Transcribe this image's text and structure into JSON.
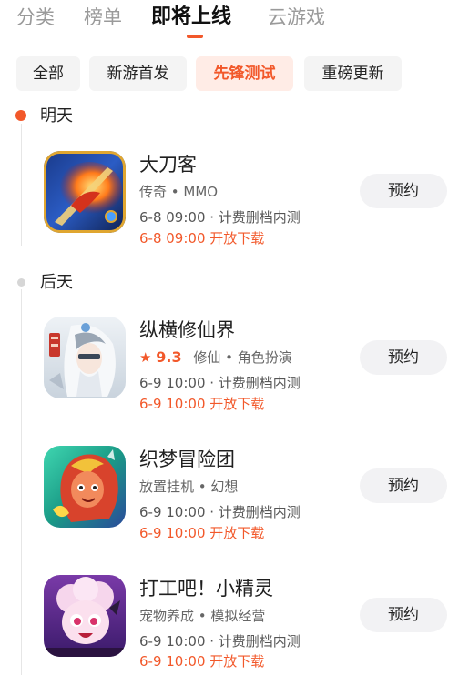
{
  "tabs": [
    {
      "label": "分类",
      "active": false
    },
    {
      "label": "榜单",
      "active": false
    },
    {
      "label": "即将上线",
      "active": true
    },
    {
      "label": "云游戏",
      "active": false
    }
  ],
  "filters": [
    {
      "label": "全部",
      "active": false
    },
    {
      "label": "新游首发",
      "active": false
    },
    {
      "label": "先锋测试",
      "active": true
    },
    {
      "label": "重磅更新",
      "active": false
    }
  ],
  "colors": {
    "accent": "#f2582a",
    "muted": "#9a9a9a",
    "chip_bg": "#f4f4f4"
  },
  "groups": [
    {
      "day": "明天",
      "games": [
        {
          "name": "大刀客",
          "tags": "传奇 • MMO",
          "rating": null,
          "test": "6-8 09:00 · 计费删档内测",
          "download": "6-8 09:00 开放下载",
          "button": "预约",
          "icon": "warrior-game-icon"
        }
      ]
    },
    {
      "day": "后天",
      "games": [
        {
          "name": "纵横修仙界",
          "tags": "修仙 • 角色扮演",
          "rating": "9.3",
          "test": "6-9 10:00 · 计费删档内测",
          "download": "6-9 10:00 开放下载",
          "button": "预约",
          "icon": "immortal-cultivator-game-icon"
        },
        {
          "name": "织梦冒险团",
          "tags": "放置挂机 • 幻想",
          "rating": null,
          "test": "6-9 10:00 · 计费删档内测",
          "download": "6-9 10:00 开放下载",
          "button": "预约",
          "icon": "fantasy-adventure-game-icon"
        },
        {
          "name": "打工吧！小精灵",
          "tags": "宠物养成 • 模拟经营",
          "rating": null,
          "test": "6-9 10:00 · 计费删档内测",
          "download": "6-9 10:00 开放下载",
          "button": "预约",
          "icon": "little-sprite-game-icon"
        }
      ]
    }
  ]
}
